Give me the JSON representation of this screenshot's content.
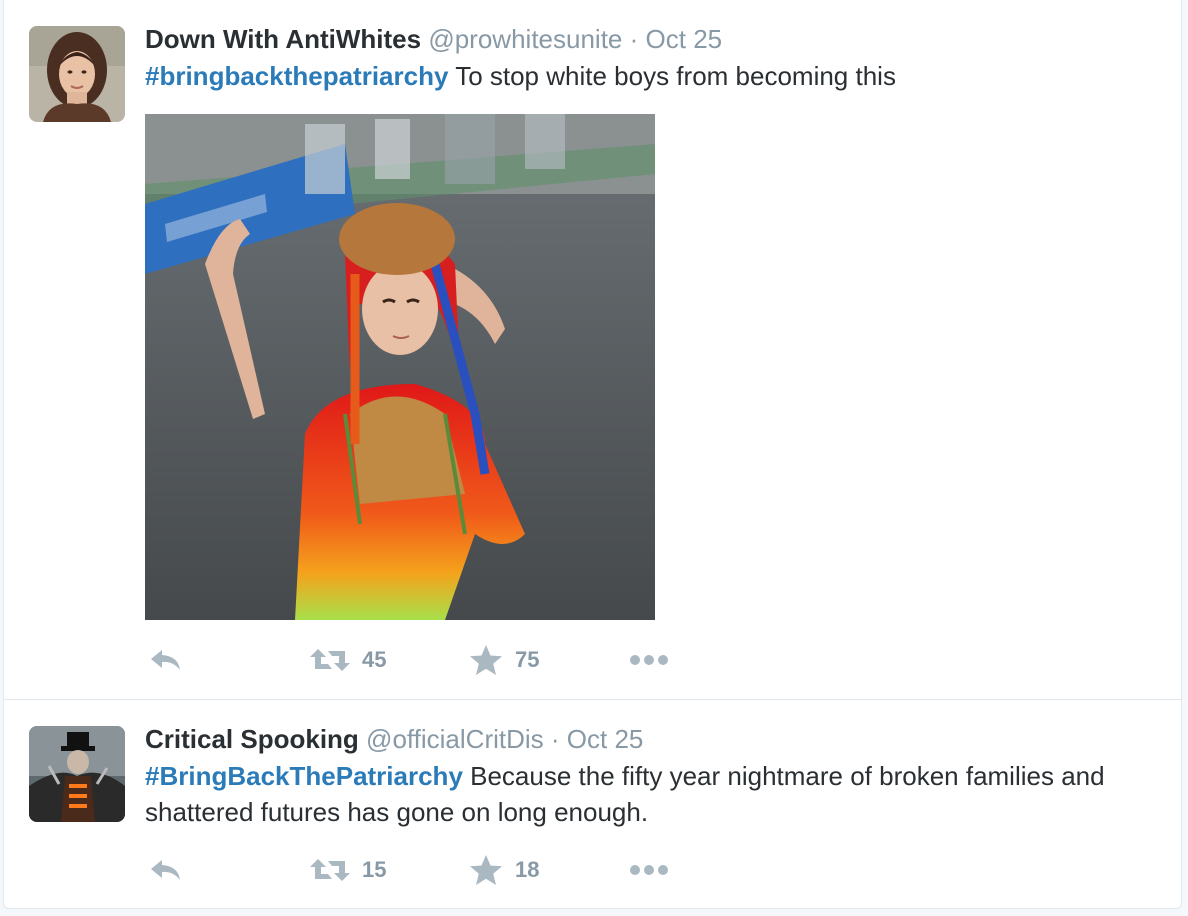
{
  "colors": {
    "link": "#2b7bb9",
    "text": "#292f33",
    "muted": "#8899a6",
    "icon": "#aab8c2",
    "border": "#e1e8ed"
  },
  "tweets": [
    {
      "fullname": "Down With AntiWhites",
      "username": "@prowhitesunite",
      "separator": "·",
      "time": "Oct 25",
      "hashtag": "#bringbackthepatriarchy",
      "text": " To stop white boys from becoming this",
      "retweets": "45",
      "favorites": "75",
      "icons": [
        "reply-icon",
        "retweet-icon",
        "star-icon",
        "more-icon"
      ]
    },
    {
      "fullname": "Critical Spooking",
      "username": "@officialCritDis",
      "separator": "·",
      "time": "Oct 25",
      "hashtag": "#BringBackThePatriarchy",
      "text": " Because the fifty year nightmare of broken families and shattered futures has gone on long enough.",
      "retweets": "15",
      "favorites": "18",
      "icons": [
        "reply-icon",
        "retweet-icon",
        "star-icon",
        "more-icon"
      ]
    }
  ]
}
